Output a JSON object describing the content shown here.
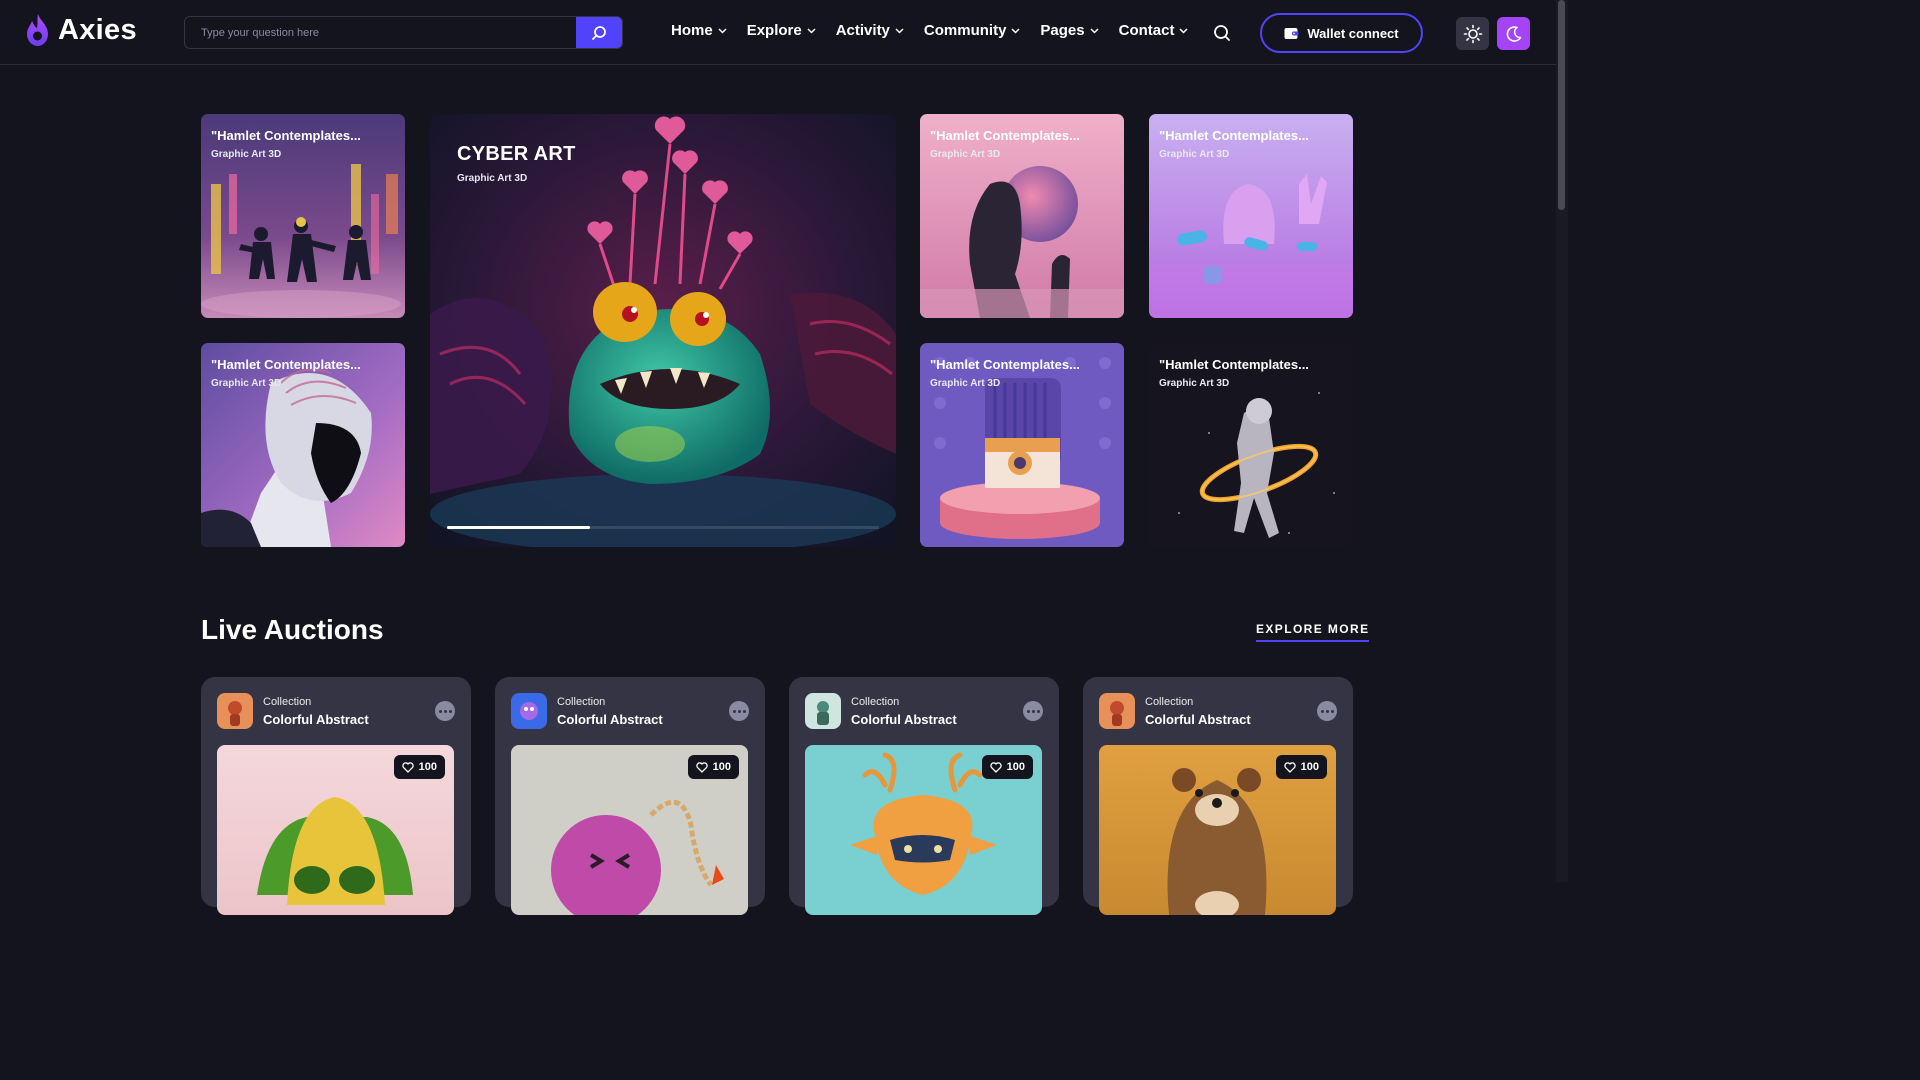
{
  "brand": {
    "name": "Axies"
  },
  "search": {
    "placeholder": "Type your question here"
  },
  "nav": {
    "items": [
      {
        "label": "Home"
      },
      {
        "label": "Explore"
      },
      {
        "label": "Activity"
      },
      {
        "label": "Community"
      },
      {
        "label": "Pages"
      },
      {
        "label": "Contact"
      }
    ]
  },
  "header": {
    "wallet_label": "Wallet connect"
  },
  "hero": {
    "main": {
      "title": "CYBER ART",
      "subtitle": "Graphic Art 3D"
    },
    "tiles": [
      {
        "title": "\"Hamlet Contemplates...",
        "subtitle": "Graphic Art 3D"
      },
      {
        "title": "\"Hamlet Contemplates...",
        "subtitle": "Graphic Art 3D"
      },
      {
        "title": "\"Hamlet Contemplates...",
        "subtitle": "Graphic Art 3D"
      },
      {
        "title": "\"Hamlet Contemplates...",
        "subtitle": "Graphic Art 3D"
      },
      {
        "title": "\"Hamlet Contemplates...",
        "subtitle": "Graphic Art 3D"
      },
      {
        "title": "\"Hamlet Contemplates...",
        "subtitle": "Graphic Art 3D"
      }
    ],
    "slider_progress": 0.33
  },
  "live_auctions": {
    "title": "Live Auctions",
    "explore_label": "EXPLORE MORE",
    "cards": [
      {
        "collection_label": "Collection",
        "name": "Colorful Abstract",
        "likes": "100"
      },
      {
        "collection_label": "Collection",
        "name": "Colorful Abstract",
        "likes": "100"
      },
      {
        "collection_label": "Collection",
        "name": "Colorful Abstract",
        "likes": "100"
      },
      {
        "collection_label": "Collection",
        "name": "Colorful Abstract",
        "likes": "100"
      }
    ]
  },
  "colors": {
    "accent": "#5142fc",
    "purple": "#a444f4",
    "bg": "#14141f",
    "card": "#343444"
  },
  "icons": [
    "flame-logo-icon",
    "search-icon",
    "chevron-down-icon",
    "wallet-icon",
    "sun-icon",
    "moon-icon",
    "heart-icon",
    "more-icon"
  ]
}
